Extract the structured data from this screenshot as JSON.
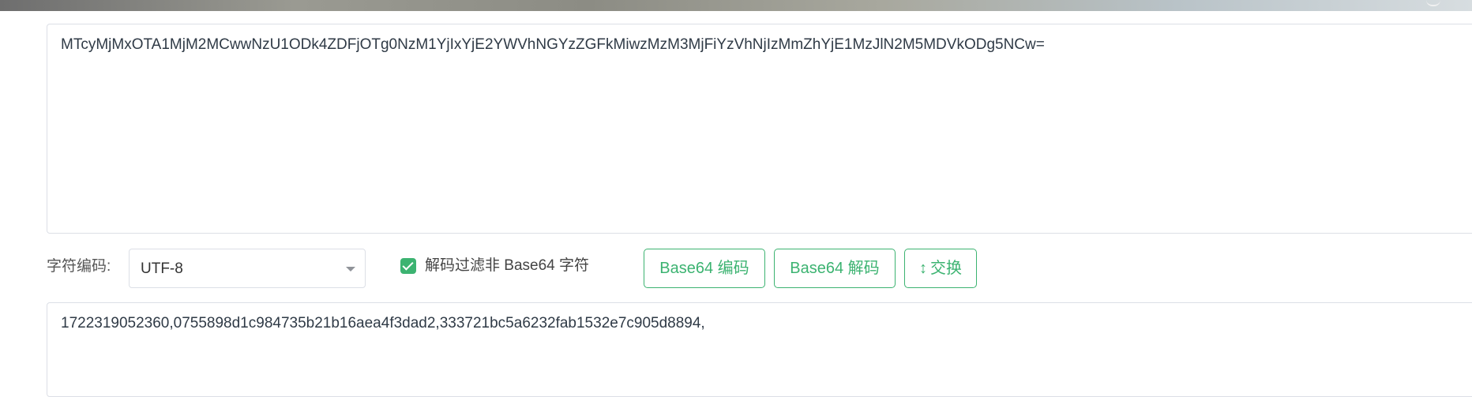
{
  "input": {
    "text": "MTcyMjMxOTA1MjM2MCwwNzU1ODk4ZDFjOTg0NzM1YjIxYjE2YWVhNGYzZGFkMiwzMzM3MjFiYzVhNjIzMmZhYjE1MzJlN2M5MDVkODg5NCw="
  },
  "controls": {
    "charset_label": "字符编码:",
    "charset_value": "UTF-8",
    "filter_checked": true,
    "filter_label": "解码过滤非 Base64 字符",
    "encode_label": "Base64 编码",
    "decode_label": "Base64 解码",
    "swap_label": "交换",
    "swap_icon": "↕"
  },
  "output": {
    "text": "1722319052360,0755898d1c984735b21b16aea4f3dad2,333721bc5a6232fab1532e7c905d8894,"
  },
  "colors": {
    "accent": "#3cb371",
    "border": "#dcdfe6"
  }
}
